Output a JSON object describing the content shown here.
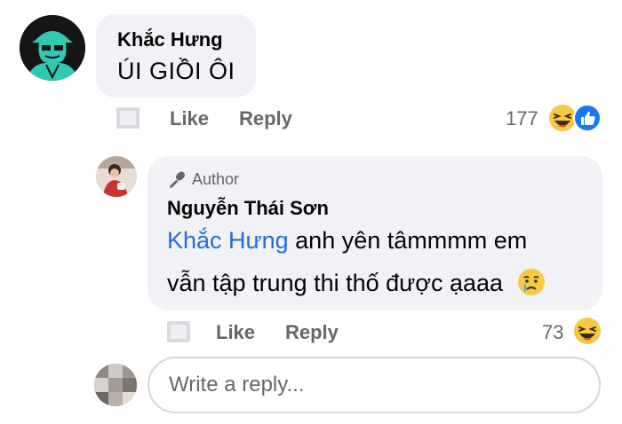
{
  "comments": [
    {
      "author": "Khắc Hưng",
      "text": "ÚI GIỒI ÔI",
      "actions": {
        "like": "Like",
        "reply": "Reply"
      },
      "reaction_count": "177",
      "reactions": [
        "laugh-emoji",
        "like-emoji"
      ]
    }
  ],
  "reply": {
    "badge": "Author",
    "author": "Nguyễn Thái Sơn",
    "mention": "Khắc Hưng",
    "text_line1": " anh yên tâmmmm em",
    "text_line2": "vẫn tập trung thi thố được ạaaa",
    "actions": {
      "like": "Like",
      "reply": "Reply"
    },
    "reaction_count": "73",
    "reactions": [
      "laugh-emoji"
    ]
  },
  "compose": {
    "placeholder": "Write a reply..."
  },
  "colors": {
    "bubble": "#f0f2f5",
    "meta": "#65676b",
    "mention": "#216fdb",
    "like_blue": "#1877f2",
    "emoji_yellow": "#f7c844"
  }
}
